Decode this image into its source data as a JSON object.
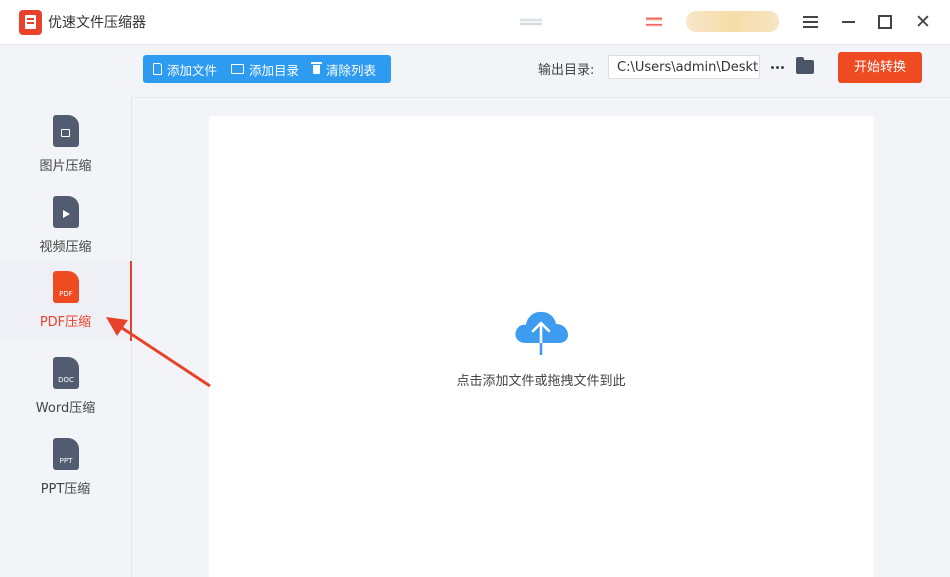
{
  "window": {
    "title": "优速文件压缩器"
  },
  "sidebar": {
    "items": [
      {
        "label": "图片压缩",
        "icon": "image-file-icon"
      },
      {
        "label": "视频压缩",
        "icon": "video-file-icon"
      },
      {
        "label": "PDF压缩",
        "icon": "pdf-file-icon",
        "icon_text": "PDF",
        "active": true
      },
      {
        "label": "Word压缩",
        "icon": "doc-file-icon",
        "icon_text": "DOC"
      },
      {
        "label": "PPT压缩",
        "icon": "ppt-file-icon",
        "icon_text": "PPT"
      }
    ]
  },
  "toolbar": {
    "add_file_label": "添加文件",
    "add_folder_label": "添加目录",
    "clear_list_label": "清除列表",
    "output_dir_label": "输出目录:",
    "output_dir_value": "C:\\Users\\admin\\Desktop",
    "start_label": "开始转换"
  },
  "drop_zone": {
    "hint": "点击添加文件或拖拽文件到此"
  },
  "colors": {
    "accent_red": "#ef4b23",
    "toolbar_blue": "#2d9bf0",
    "cloud_blue": "#3d9bf0",
    "icon_gray": "#515c70"
  }
}
